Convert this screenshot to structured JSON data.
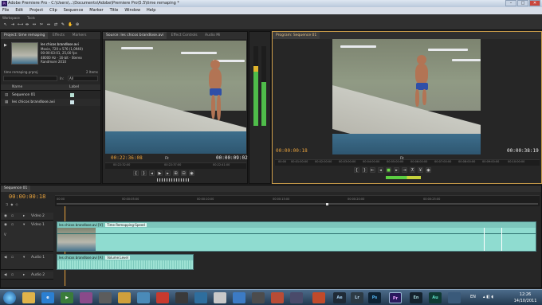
{
  "window": {
    "title": "Adobe Premiere Pro - C:\\Users\\...\\Documents\\Adobe\\Premiere Pro\\5.5\\time remaping *",
    "app_icon": "Pr"
  },
  "menu": [
    "File",
    "Edit",
    "Project",
    "Clip",
    "Sequence",
    "Marker",
    "Title",
    "Window",
    "Help"
  ],
  "workspace": {
    "label": "Workspace",
    "tools_label": "Tools"
  },
  "project_panel": {
    "tabs": [
      "Project: time remaping",
      "Effects",
      "Markers"
    ],
    "clip_name": "les chicos brandlose.avi",
    "clip_info": [
      "Movie, 720 x 576 (1,0940)",
      "00:00:03:01, 25,00 fps",
      "48000 Hz - 16-bit - Stereo",
      "Randmore 2010"
    ],
    "project_file": "time remaping.prproj",
    "item_count": "2 Items",
    "in_label": "In:",
    "in_value": "All",
    "col_name": "Name",
    "col_label": "Label",
    "items": [
      {
        "name": "Sequence 01",
        "label_color": "#b8e0d4"
      },
      {
        "name": "les chicos brandlose.avi",
        "label_color": "#cfe6ea"
      }
    ]
  },
  "source_monitor": {
    "tabs": [
      "Source: les chicos brandlose.avi",
      "Effect Controls",
      "Audio Mi"
    ],
    "timecode": "00:22:36:08",
    "fit": "Fit",
    "duration": "00:00:09:02",
    "ruler": [
      "00:22:32:00",
      "00:22:37:00",
      "00:22:41:00"
    ]
  },
  "program_monitor": {
    "tabs": [
      "Program: Sequence 01"
    ],
    "timecode": "00:00:00:18",
    "fit": "Fit",
    "duration": "00:00:38:19",
    "ruler": [
      "00:00",
      "00:01:00:00",
      "00:02:00:00",
      "00:03:00:00",
      "00:04:00:00",
      "00:05:00:00",
      "00:06:00:00",
      "00:07:00:00",
      "00:08:00:00",
      "00:09:00:00",
      "00:10:00:00"
    ]
  },
  "timeline": {
    "tab": "Sequence 01",
    "timecode": "00:00:00:18",
    "ruler": [
      "00:00",
      "00:00:05:00",
      "00:00:10:00",
      "00:00:15:00",
      "00:00:20:00",
      "00:00:25:00"
    ],
    "tracks": [
      {
        "name": "Video 2",
        "type": "video"
      },
      {
        "name": "Video 1",
        "type": "video"
      },
      {
        "name": "Audio 1",
        "type": "audio"
      },
      {
        "name": "Audio 2",
        "type": "audio"
      }
    ],
    "video_clip": {
      "name": "les chicos brandlose.avi [V]",
      "effect": "Time Remapping:Speed"
    },
    "audio_clip": {
      "name": "les chicos brandlose.avi [A]",
      "effect": "Volume:Level"
    }
  },
  "taskbar": {
    "apps": [
      "Ae",
      "Lr",
      "Ps",
      "Pr",
      "En",
      "Au"
    ],
    "lang": "EN",
    "time": "12:26",
    "date": "14/10/2011"
  },
  "colors": {
    "timecode": "#e8a23d",
    "clip_video": "#8fdcd0",
    "clip_audio": "#9ee2d4"
  }
}
